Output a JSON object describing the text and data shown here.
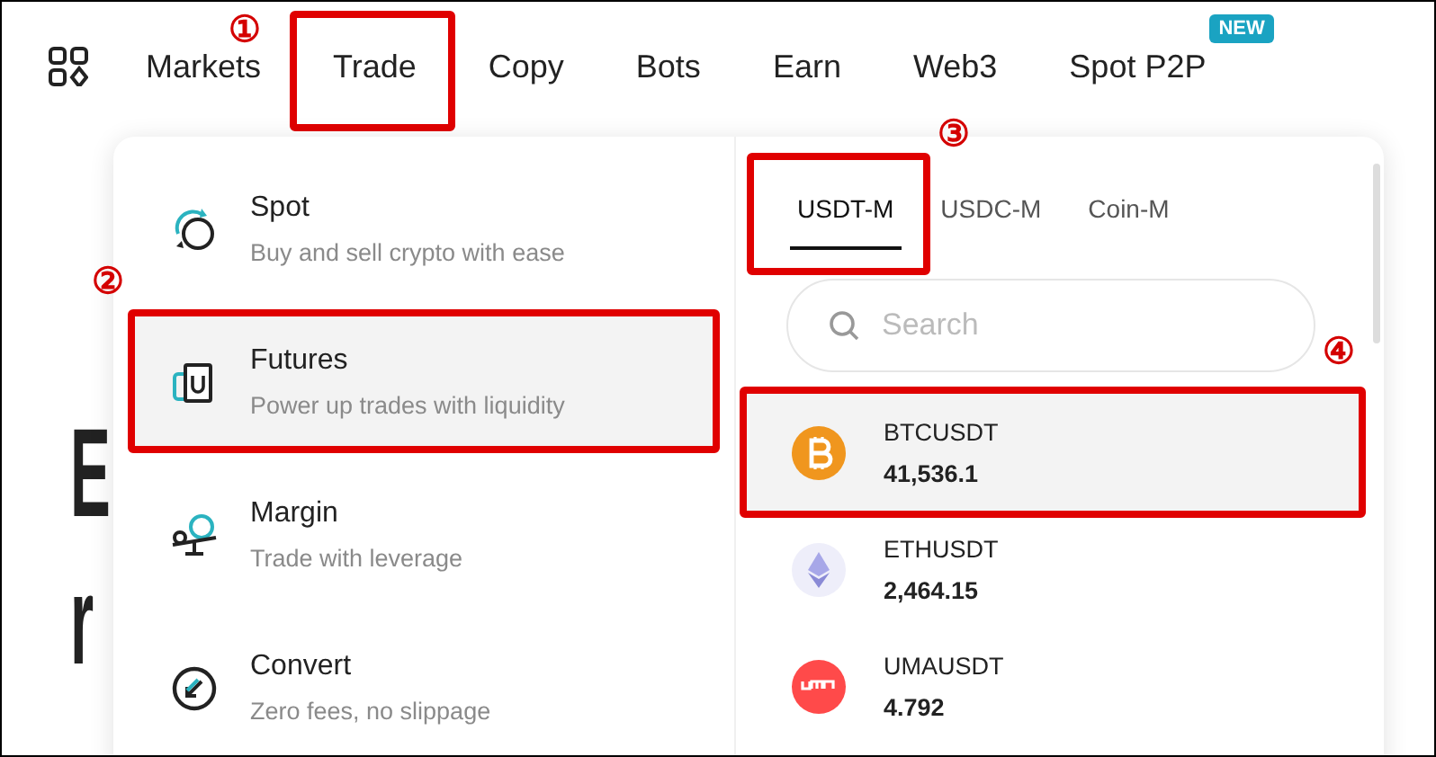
{
  "nav": {
    "items": [
      {
        "label": "Markets"
      },
      {
        "label": "Trade",
        "annotation": "①"
      },
      {
        "label": "Copy"
      },
      {
        "label": "Bots"
      },
      {
        "label": "Earn"
      },
      {
        "label": "Web3"
      },
      {
        "label": "Spot P2P",
        "badge": "NEW"
      }
    ]
  },
  "hero_fragments": [
    "E",
    "r"
  ],
  "trade_menu": {
    "items": [
      {
        "kind": "spot",
        "title": "Spot",
        "subtitle": "Buy and sell crypto with ease",
        "highlighted": false
      },
      {
        "kind": "futures",
        "title": "Futures",
        "subtitle": "Power up trades with liquidity",
        "highlighted": true,
        "annotation": "②"
      },
      {
        "kind": "margin",
        "title": "Margin",
        "subtitle": "Trade with leverage",
        "highlighted": false
      },
      {
        "kind": "convert",
        "title": "Convert",
        "subtitle": "Zero fees, no slippage",
        "highlighted": false
      }
    ]
  },
  "futures_panel": {
    "tabs": [
      {
        "label": "USDT-M",
        "selected": true,
        "annotation": "③"
      },
      {
        "label": "USDC-M",
        "selected": false
      },
      {
        "label": "Coin-M",
        "selected": false
      }
    ],
    "search": {
      "placeholder": "Search"
    },
    "rows": [
      {
        "kind": "btc",
        "symbol": "BTCUSDT",
        "price": "41,536.1",
        "highlighted": true,
        "annotation": "④"
      },
      {
        "kind": "eth",
        "symbol": "ETHUSDT",
        "price": "2,464.15",
        "highlighted": false
      },
      {
        "kind": "uma",
        "symbol": "UMAUSDT",
        "price": "4.792",
        "highlighted": false
      }
    ]
  }
}
